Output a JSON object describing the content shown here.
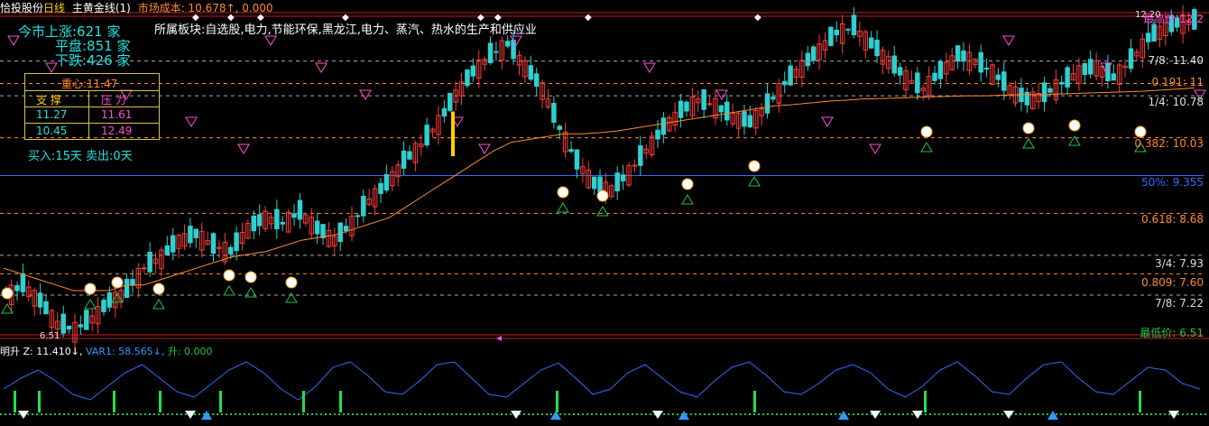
{
  "topbar": {
    "stock_name": "恰投股份",
    "period": "日线",
    "indicator": "主黄金线(1)",
    "cost_label": "市场成本: 10.678↑, 0.000"
  },
  "sector": "所属板块:自选股,电力,节能环保,黑龙江,电力、蒸汽、热水的生产和供应业",
  "market": {
    "up_label": "今市上涨:621 家",
    "flat_label": "平盘:851 家",
    "down_label": "下跌:426 家"
  },
  "center": {
    "title": "重心:11.47",
    "support_label": "支 撑",
    "pressure_label": "压 力",
    "support1": "11.27",
    "pressure1": "11.61",
    "support2": "10.45",
    "pressure2": "12.49"
  },
  "buy_sell": "买入:15天  卖出:0天",
  "levels": {
    "high_label": "最高价:12.2",
    "l78": "7/8: 11.40",
    "l0191": "0.191: 11",
    "l14": "1/4: 10.78",
    "l0382": "0.382: 10.03",
    "l50": "50%: 9.355",
    "l0618": "0.618: 8.68",
    "l34": "3/4: 7.93",
    "l0809": "0.809: 7.60",
    "l78b": "7/8: 7.22",
    "low_label": "最低价: 6.51",
    "low_marker": "6.51",
    "top_time": "12.20"
  },
  "indicator_row": {
    "name": "明升",
    "z": "Z: 11.410↓,",
    "var1": "VAR1: 58.565↓,",
    "sheng": "升: 0.000"
  },
  "colors": {
    "up": "#ff3b3b",
    "down": "#2fd0d0",
    "ma": "#ff8a2a",
    "accent": "#ff4fd8",
    "blue": "#2e6cff",
    "orange": "#ff7a1a",
    "yellow": "#ffd000"
  },
  "chart_data": {
    "type": "candlestick",
    "y_range": [
      6.51,
      12.2
    ],
    "levels": [
      12.2,
      11.4,
      11.0,
      10.78,
      10.03,
      9.355,
      8.68,
      7.93,
      7.6,
      7.22,
      6.51
    ],
    "close_series": [
      7.2,
      7.4,
      7.1,
      6.7,
      6.6,
      6.8,
      7.1,
      7.3,
      7.7,
      7.9,
      8.2,
      8.3,
      8.1,
      8.0,
      8.4,
      8.6,
      8.5,
      8.7,
      8.4,
      8.2,
      8.5,
      8.9,
      9.2,
      9.6,
      9.9,
      10.3,
      10.8,
      11.2,
      11.5,
      11.7,
      11.3,
      10.9,
      10.2,
      9.6,
      9.2,
      9.1,
      9.4,
      9.8,
      10.2,
      10.5,
      10.7,
      10.6,
      10.4,
      10.3,
      10.6,
      11.0,
      11.3,
      11.6,
      11.9,
      12.0,
      11.7,
      11.4,
      11.1,
      10.9,
      11.2,
      11.5,
      11.4,
      11.2,
      10.9,
      10.7,
      10.8,
      11.0,
      11.2,
      11.3,
      11.1,
      11.4,
      11.8,
      12.0,
      12.1
    ],
    "ma_series": [
      7.7,
      7.6,
      7.5,
      7.4,
      7.3,
      7.3,
      7.3,
      7.4,
      7.4,
      7.5,
      7.6,
      7.7,
      7.8,
      7.9,
      7.95,
      8.0,
      8.1,
      8.2,
      8.25,
      8.3,
      8.4,
      8.5,
      8.6,
      8.8,
      9.0,
      9.2,
      9.4,
      9.6,
      9.8,
      9.95,
      10.0,
      10.05,
      10.1,
      10.1,
      10.12,
      10.15,
      10.2,
      10.25,
      10.3,
      10.35,
      10.4,
      10.45,
      10.5,
      10.55,
      10.6,
      10.62,
      10.65,
      10.68,
      10.7,
      10.72,
      10.73,
      10.74,
      10.75,
      10.76,
      10.77,
      10.78,
      10.78,
      10.79,
      10.8,
      10.8,
      10.81,
      10.82,
      10.83,
      10.84,
      10.85,
      10.86,
      10.88,
      10.9,
      10.92
    ],
    "var1_series": [
      40,
      60,
      75,
      55,
      30,
      20,
      45,
      70,
      85,
      60,
      35,
      25,
      50,
      75,
      90,
      70,
      40,
      20,
      45,
      80,
      90,
      65,
      35,
      30,
      55,
      85,
      90,
      60,
      30,
      25,
      50,
      75,
      88,
      60,
      30,
      40,
      70,
      85,
      60,
      35,
      25,
      55,
      80,
      90,
      65,
      35,
      30,
      50,
      75,
      85,
      70,
      40,
      25,
      45,
      75,
      90,
      65,
      35,
      30,
      60,
      85,
      90,
      60,
      35,
      30,
      55,
      80,
      75,
      50,
      40
    ]
  }
}
